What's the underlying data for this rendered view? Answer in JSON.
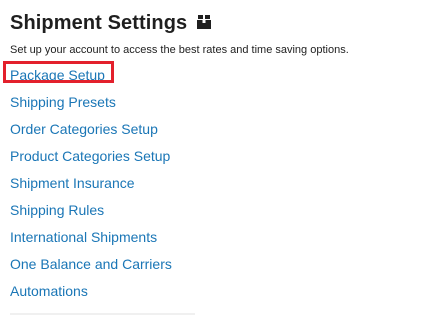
{
  "header": {
    "title": "Shipment Settings",
    "title_icon": "package-box-icon",
    "subtitle": "Set up your account to access the best rates and time saving options."
  },
  "links": [
    {
      "label": "Package Setup",
      "highlighted": true
    },
    {
      "label": "Shipping Presets"
    },
    {
      "label": "Order Categories Setup"
    },
    {
      "label": "Product Categories Setup"
    },
    {
      "label": "Shipment Insurance"
    },
    {
      "label": "Shipping Rules"
    },
    {
      "label": "International Shipments"
    },
    {
      "label": "One Balance and Carriers"
    },
    {
      "label": "Automations"
    }
  ],
  "colors": {
    "link": "#1a76b6",
    "highlight": "#e3202c",
    "title": "#1f1f1f"
  }
}
